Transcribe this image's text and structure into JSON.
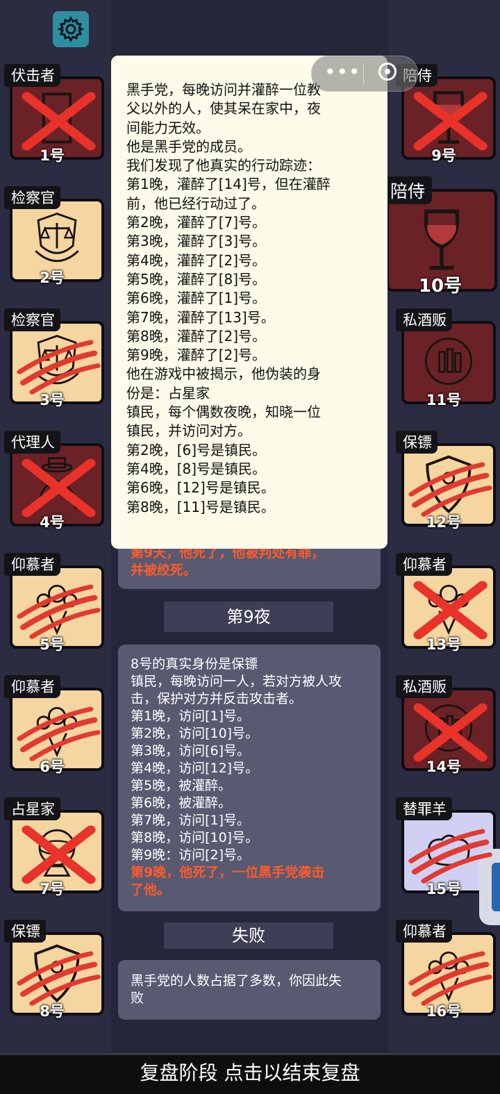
{
  "settings_icon": "gear-icon",
  "colors": {
    "popup_bg": "#fdfbe9",
    "death_text": "#ff5a2b",
    "panel_bg": "#585a72"
  },
  "left_players": [
    {
      "role": "伏击者",
      "num": "1号",
      "bg": "red",
      "icon": "door-icon",
      "mark": "cross"
    },
    {
      "role": "检察官",
      "num": "2号",
      "bg": "cream",
      "icon": "scales-badge-icon",
      "mark": "none"
    },
    {
      "role": "检察官",
      "num": "3号",
      "bg": "cream",
      "icon": "scales-badge-icon",
      "mark": "claw"
    },
    {
      "role": "代理人",
      "num": "4号",
      "bg": "red",
      "icon": "agent-icon",
      "mark": "cross"
    },
    {
      "role": "仰慕者",
      "num": "5号",
      "bg": "cream",
      "icon": "bouquet-icon",
      "mark": "claw"
    },
    {
      "role": "仰慕者",
      "num": "6号",
      "bg": "cream",
      "icon": "bouquet-icon",
      "mark": "claw"
    },
    {
      "role": "占星家",
      "num": "7号",
      "bg": "cream",
      "icon": "astrolabe-icon",
      "mark": "cross"
    },
    {
      "role": "保镖",
      "num": "8号",
      "bg": "cream",
      "icon": "shield-icon",
      "mark": "claw"
    }
  ],
  "right_players": [
    {
      "role": "陪侍",
      "num": "9号",
      "bg": "red",
      "icon": "wine-glass-icon",
      "mark": "cross"
    },
    {
      "role": "陪侍",
      "num": "10号",
      "bg": "red",
      "icon": "wine-glass-icon",
      "mark": "none"
    },
    {
      "role": "私酒贩",
      "num": "11号",
      "bg": "red",
      "icon": "bottles-icon",
      "mark": "none"
    },
    {
      "role": "保镖",
      "num": "12号",
      "bg": "cream",
      "icon": "shield-icon",
      "mark": "claw"
    },
    {
      "role": "仰慕者",
      "num": "13号",
      "bg": "cream",
      "icon": "bouquet-icon",
      "mark": "cross"
    },
    {
      "role": "私酒贩",
      "num": "14号",
      "bg": "red",
      "icon": "bottles-icon",
      "mark": "cross"
    },
    {
      "role": "替罪羊",
      "num": "15号",
      "bg": "lav",
      "icon": "sheep-icon",
      "mark": "claw"
    },
    {
      "role": "仰慕者",
      "num": "16号",
      "bg": "cream",
      "icon": "bouquet-icon",
      "mark": "claw"
    }
  ],
  "popup_lines": [
    "黑手党，每晚访问并灌醉一位教",
    "父以外的人，使其呆在家中，夜",
    "间能力无效。",
    "他是黑手党的成员。",
    "我们发现了他真实的行动踪迹：",
    "第1晚，灌醉了[14]号，但在灌醉",
    "前，他已经行动过了。",
    "第2晚，灌醉了[7]号。",
    "第3晚，灌醉了[3]号。",
    "第4晚，灌醉了[2]号。",
    "第5晚，灌醉了[8]号。",
    "第6晚，灌醉了[1]号。",
    "第7晚，灌醉了[13]号。",
    "第8晚，灌醉了[2]号。",
    "第9晚，灌醉了[2]号。",
    "他在游戏中被揭示，他伪装的身",
    "份是：占星家",
    "镇民，每个偶数夜晚，知晓一位",
    "镇民，并访问对方。",
    "第2晚，[6]号是镇民。",
    "第4晚，[8]号是镇民。",
    "第6晚，[12]号是镇民。",
    "第8晚，[11]号是镇民。"
  ],
  "partial_panel": {
    "red_lines": [
      "第9天，他死了，他被判处有罪，",
      "并被绞死。"
    ]
  },
  "night9": {
    "title": "第9夜",
    "lines": [
      "8号的真实身份是保镖",
      "镇民，每晚访问一人，若对方被人攻",
      "击，保护对方并反击攻击者。",
      "第1晚，访问[1]号。",
      "第2晚，访问[10]号。",
      "第3晚，访问[6]号。",
      "第4晚，访问[12]号。",
      "第5晚，被灌醉。",
      "第6晚，被灌醉。",
      "第7晚，访问[1]号。",
      "第8晚，访问[10]号。",
      "第9晚：访问[2]号。"
    ],
    "red_lines": [
      "第9晚，他死了，一位黑手党袭击",
      "了他。"
    ]
  },
  "fail": {
    "title": "失败",
    "lines": [
      "黑手党的人数占据了多数，你因此失",
      "败"
    ]
  },
  "bottom_bar": "复盘阶段 点击以结束复盘",
  "capsule": {
    "menu_icon": "more-dots-icon",
    "close_icon": "target-circle-icon"
  }
}
